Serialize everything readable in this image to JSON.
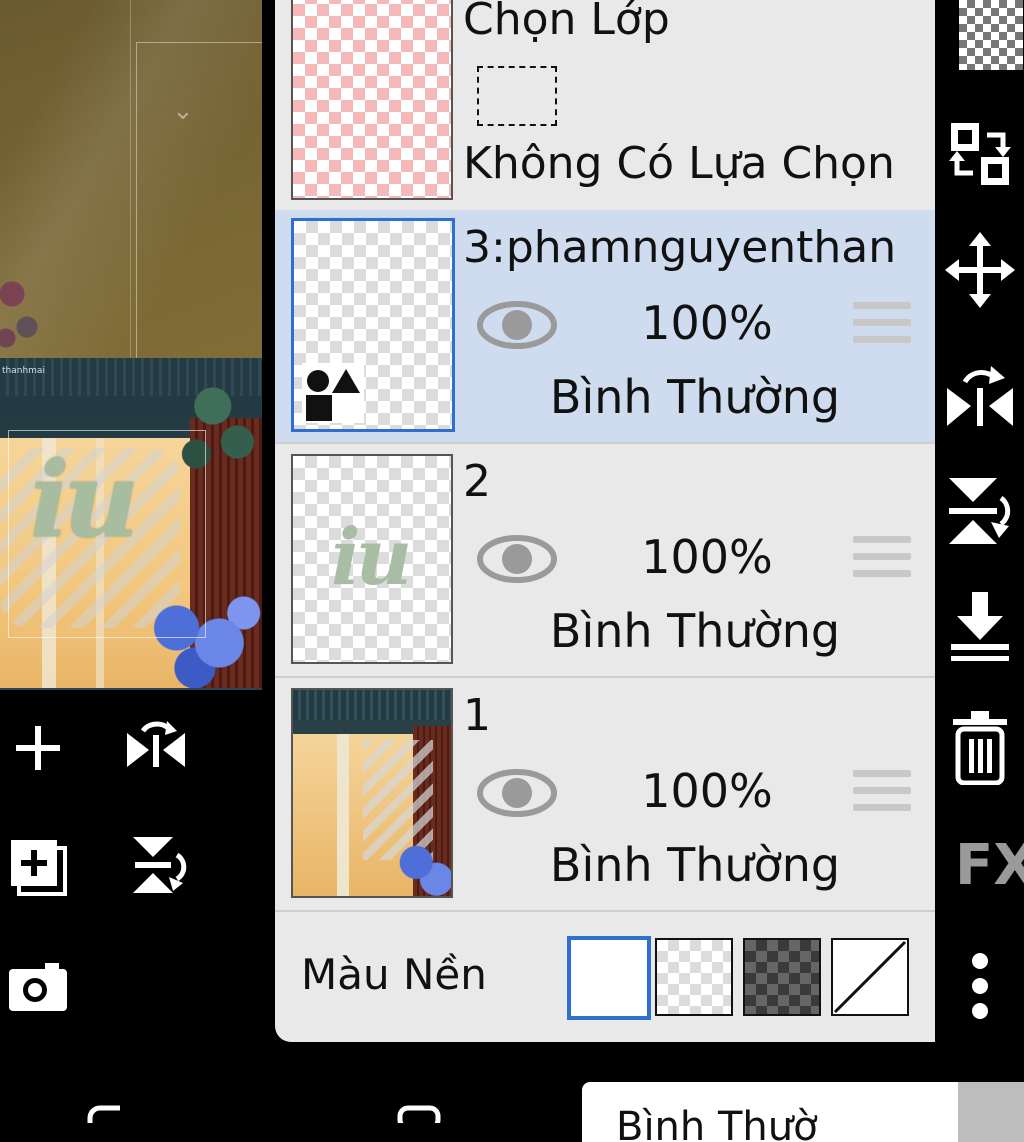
{
  "canvas": {
    "photo_tag": "thanhmai",
    "overlay_text": "iu"
  },
  "layers_panel": {
    "selection_layer": {
      "title": "Chọn Lớp",
      "status": "Không Có Lựa Chọn"
    },
    "layers": [
      {
        "name": "3:phamnguyenthan",
        "opacity": "100%",
        "blend_mode": "Bình Thường",
        "selected": true,
        "kind": "vector"
      },
      {
        "name": "2",
        "opacity": "100%",
        "blend_mode": "Bình Thường",
        "selected": false,
        "kind": "text-art"
      },
      {
        "name": "1",
        "opacity": "100%",
        "blend_mode": "Bình Thường",
        "selected": false,
        "kind": "photo"
      }
    ],
    "background": {
      "label": "Màu Nền",
      "options": [
        "white",
        "transparent-light",
        "transparent-dark",
        "none"
      ],
      "selected": "white"
    }
  },
  "right_toolbar": {
    "fx_label": "FX"
  },
  "bottom_bar": {
    "blend_dropdown_value": "Bình Thườ"
  },
  "colors": {
    "selected_row": "#cfdcef",
    "selection_accent": "#2f6fd0",
    "panel_bg": "#e9e9e9"
  }
}
